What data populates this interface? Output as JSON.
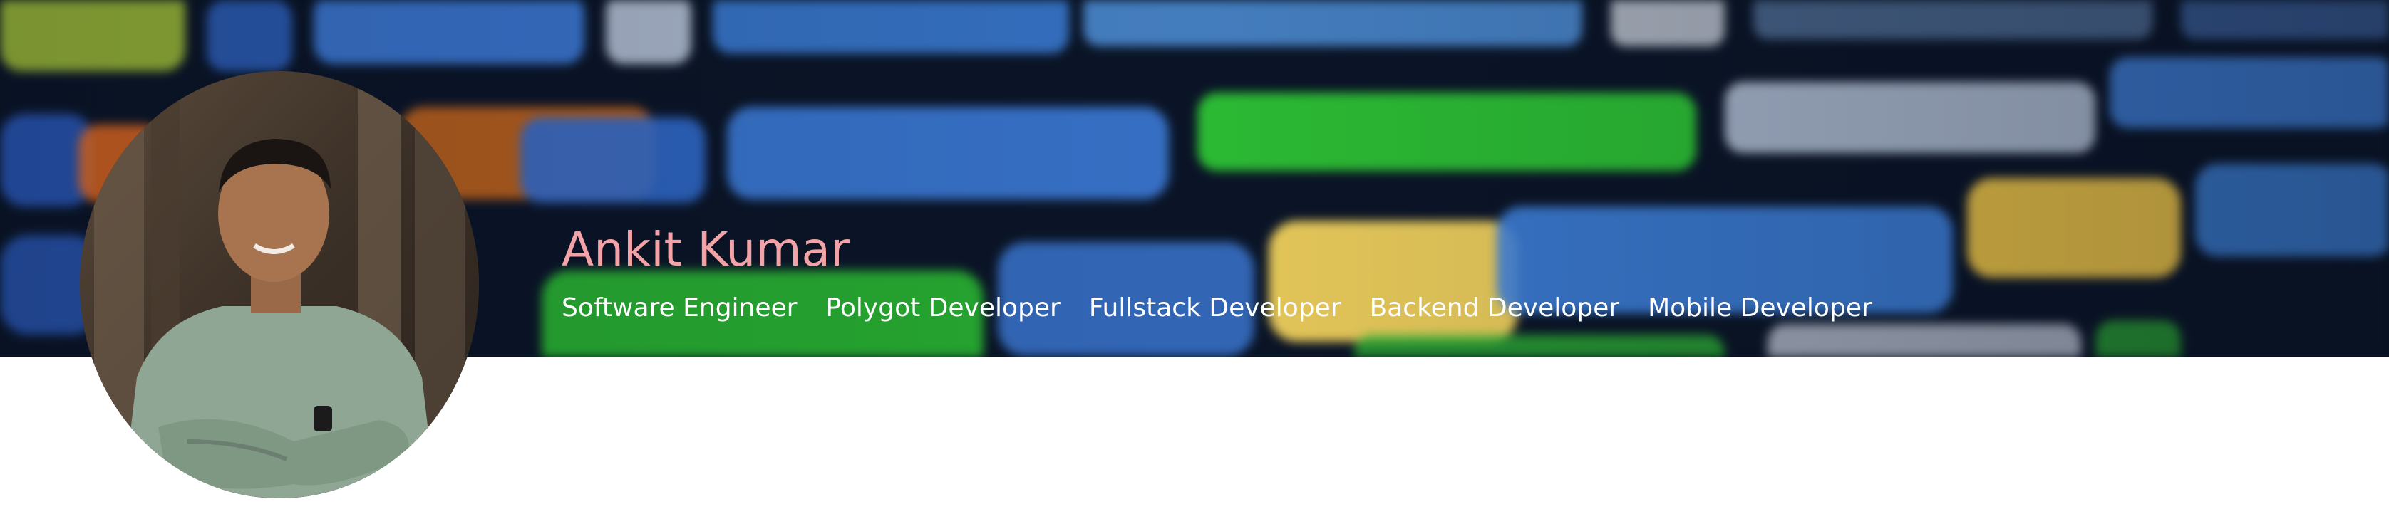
{
  "profile": {
    "name": "Ankit Kumar",
    "roles": [
      "Software Engineer",
      "Polygot Developer",
      "Fullstack Developer",
      "Backend Developer",
      "Mobile Developer"
    ]
  },
  "colors": {
    "name": "#f2a3a7",
    "roles": "#ffffff",
    "banner_background": "#081322",
    "page_background": "#ffffff"
  },
  "banner": {
    "decoration": "blurred source code in dark editor"
  },
  "avatar": {
    "icon": "profile-photo"
  }
}
